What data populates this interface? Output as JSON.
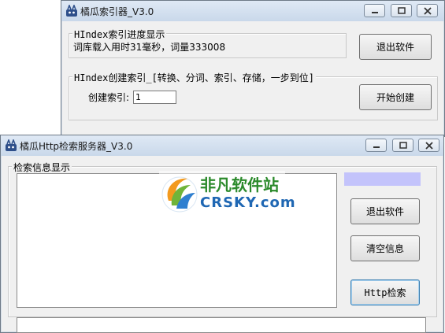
{
  "indexer": {
    "title": "橘瓜索引器_V3.0",
    "progress_group": {
      "legend": "HIndex索引进度显示",
      "status": "词库载入用时31毫秒，词量333008"
    },
    "exit_button": "退出软件",
    "create_group": {
      "legend": "HIndex创建索引_[转换、分词、索引、存储，一步到位]",
      "field_label": "创建索引:",
      "field_value": "1"
    },
    "start_button": "开始创建"
  },
  "server": {
    "title": "橘瓜Http检索服务器_V3.0",
    "group_legend": "检索信息显示",
    "exit_button": "退出软件",
    "clear_button": "清空信息",
    "http_button": "Http检索"
  },
  "watermark": {
    "brand": "非凡软件站",
    "url": "CRSKY.com"
  },
  "colors": {
    "status_strip": "#c3c3fb",
    "brand_green": "#2b8a2b",
    "brand_blue": "#1f67b3"
  }
}
